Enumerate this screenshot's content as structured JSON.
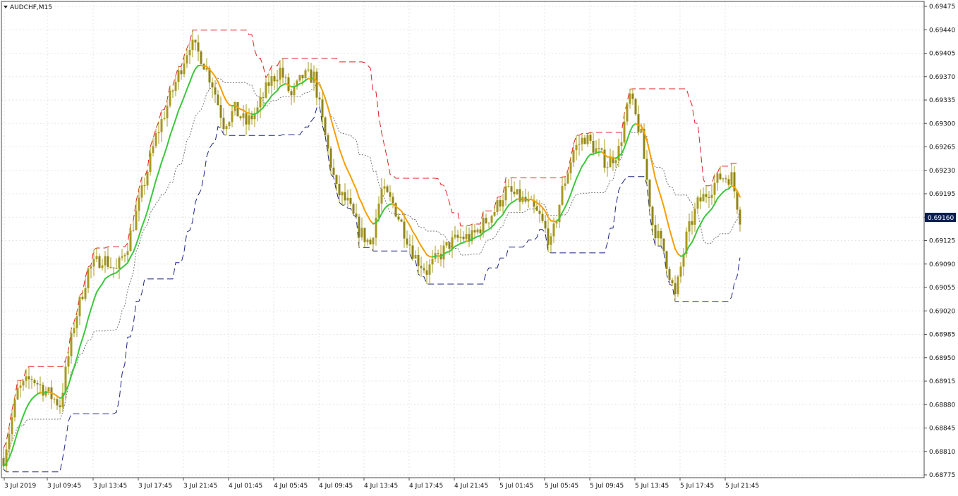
{
  "window": {
    "title": "AUDCHF,M15",
    "menu_icon": "triangle-down-icon"
  },
  "chart_data": {
    "type": "candlestick",
    "symbol": "AUDCHF",
    "timeframe": "M15",
    "ylim": [
      0.6874,
      0.6948
    ],
    "y_ticks": [
      "0.69475",
      "0.69440",
      "0.69405",
      "0.69370",
      "0.69335",
      "0.69300",
      "0.69265",
      "0.69230",
      "0.69195",
      "0.69160",
      "0.69125",
      "0.69090",
      "0.69055",
      "0.69020",
      "0.68985",
      "0.68950",
      "0.68915",
      "0.68880",
      "0.68845",
      "0.68810",
      "0.68775"
    ],
    "x_ticks": [
      "3 Jul 2019",
      "3 Jul 09:45",
      "3 Jul 13:45",
      "3 Jul 17:45",
      "3 Jul 21:45",
      "4 Jul 01:45",
      "4 Jul 05:45",
      "4 Jul 09:45",
      "4 Jul 13:45",
      "4 Jul 17:45",
      "4 Jul 21:45",
      "5 Jul 01:45",
      "5 Jul 05:45",
      "5 Jul 09:45",
      "5 Jul 13:45",
      "5 Jul 17:45",
      "5 Jul 21:45"
    ],
    "current_price": "0.69160",
    "grid": true,
    "colors": {
      "background": "#ffffff",
      "axis": "#4a4a4a",
      "grid": "#e6e6e6",
      "candle": "#a89a1e",
      "candle_body_bear": "#8f8418",
      "ma_up": "#3cc83c",
      "ma_down": "#f5a000",
      "upper_band": "#e02020",
      "lower_band": "#1a237e",
      "middle_band": "#777777",
      "price_label_bg": "#0a1f4f",
      "price_label_text": "#ffffff"
    },
    "close_points": [
      [
        0,
        0.688
      ],
      [
        5,
        0.689
      ],
      [
        10,
        0.6892
      ],
      [
        15,
        0.689
      ],
      [
        20,
        0.6888
      ],
      [
        25,
        0.69
      ],
      [
        30,
        0.6908
      ],
      [
        35,
        0.691
      ],
      [
        40,
        0.6908
      ],
      [
        44,
        0.6912
      ],
      [
        48,
        0.6918
      ],
      [
        54,
        0.6928
      ],
      [
        60,
        0.6935
      ],
      [
        66,
        0.6942
      ],
      [
        70,
        0.694
      ],
      [
        74,
        0.6936
      ],
      [
        78,
        0.693
      ],
      [
        82,
        0.6932
      ],
      [
        86,
        0.693
      ],
      [
        90,
        0.6932
      ],
      [
        94,
        0.6936
      ],
      [
        98,
        0.6938
      ],
      [
        102,
        0.6934
      ],
      [
        106,
        0.6937
      ],
      [
        110,
        0.6937
      ],
      [
        114,
        0.6928
      ],
      [
        118,
        0.692
      ],
      [
        122,
        0.6918
      ],
      [
        126,
        0.6914
      ],
      [
        130,
        0.6912
      ],
      [
        134,
        0.692
      ],
      [
        138,
        0.6918
      ],
      [
        142,
        0.6914
      ],
      [
        146,
        0.691
      ],
      [
        150,
        0.6908
      ],
      [
        154,
        0.691
      ],
      [
        158,
        0.6912
      ],
      [
        162,
        0.6913
      ],
      [
        166,
        0.6913
      ],
      [
        170,
        0.6915
      ],
      [
        174,
        0.6917
      ],
      [
        178,
        0.692
      ],
      [
        182,
        0.6919
      ],
      [
        186,
        0.6918
      ],
      [
        190,
        0.6916
      ],
      [
        194,
        0.6912
      ],
      [
        198,
        0.692
      ],
      [
        202,
        0.6926
      ],
      [
        206,
        0.6928
      ],
      [
        210,
        0.6926
      ],
      [
        214,
        0.6924
      ],
      [
        218,
        0.6926
      ],
      [
        222,
        0.6934
      ],
      [
        226,
        0.6928
      ],
      [
        230,
        0.6915
      ],
      [
        234,
        0.6911
      ],
      [
        238,
        0.6904
      ],
      [
        242,
        0.6913
      ],
      [
        246,
        0.6918
      ],
      [
        250,
        0.692
      ],
      [
        254,
        0.6922
      ],
      [
        258,
        0.6922
      ],
      [
        261,
        0.6916
      ]
    ]
  }
}
